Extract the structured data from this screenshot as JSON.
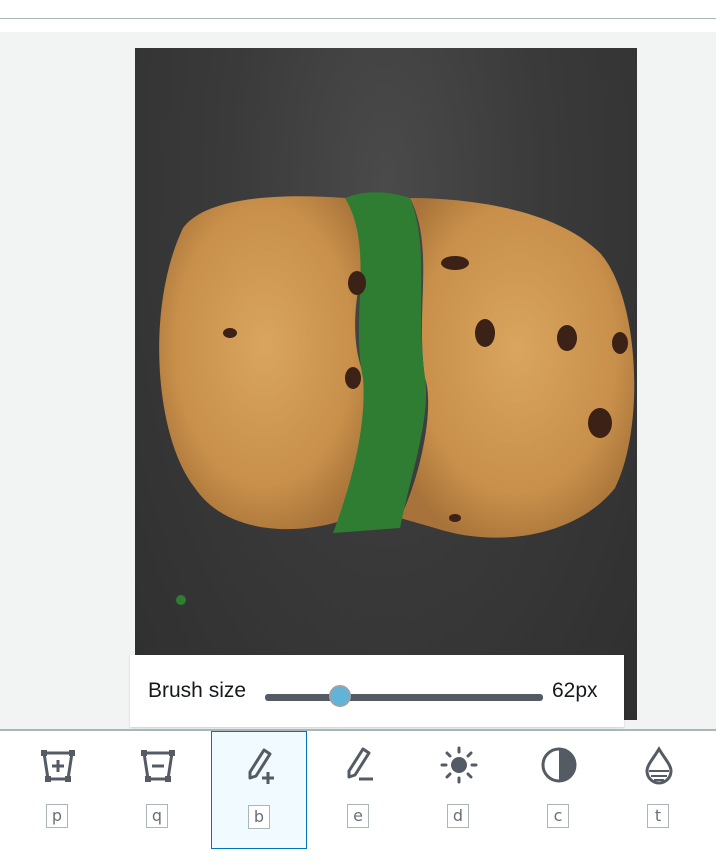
{
  "brush": {
    "label": "Brush size",
    "value": "62px",
    "level": 0.27
  },
  "tools": [
    {
      "icon": "add-vertex-icon",
      "key": "p",
      "selected": false
    },
    {
      "icon": "remove-vertex-icon",
      "key": "q",
      "selected": false
    },
    {
      "icon": "brush-add-icon",
      "key": "b",
      "selected": true
    },
    {
      "icon": "brush-erase-icon",
      "key": "e",
      "selected": false
    },
    {
      "icon": "brightness-icon",
      "key": "d",
      "selected": false
    },
    {
      "icon": "contrast-icon",
      "key": "c",
      "selected": false
    },
    {
      "icon": "transparency-icon",
      "key": "t",
      "selected": false
    }
  ],
  "colors": {
    "mask": "#2e7d32",
    "accent": "#0073bb",
    "slider_thumb": "#5fb4d8"
  }
}
